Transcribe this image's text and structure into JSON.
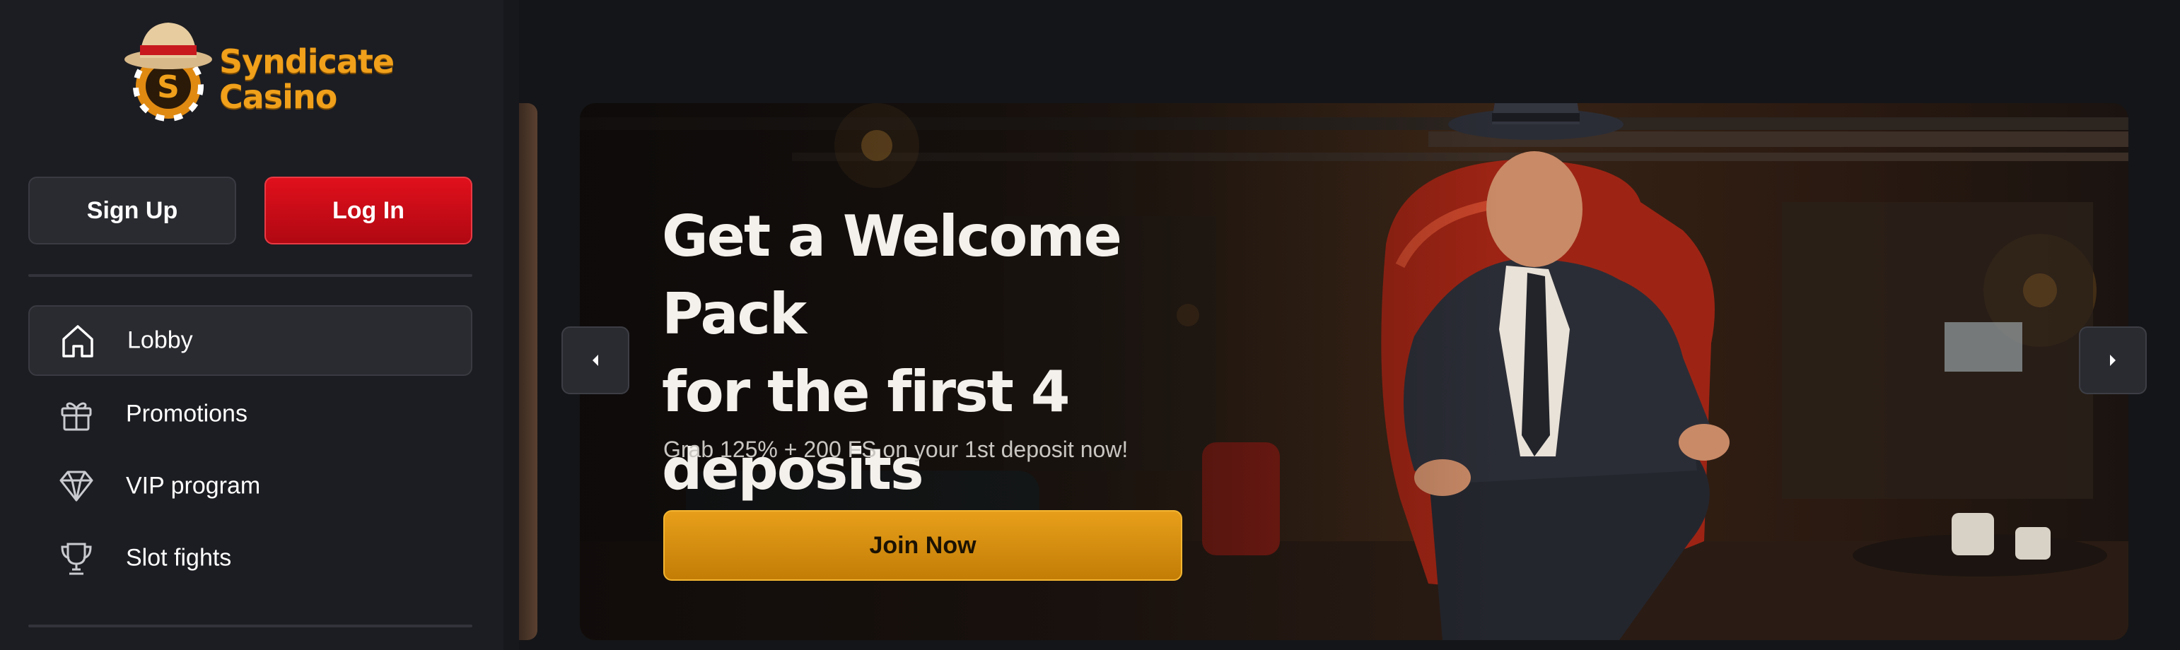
{
  "brand": {
    "logo_text_line1": "Syndicate",
    "logo_text_line2": "Casino",
    "accent": "#f0a01a"
  },
  "auth": {
    "signup_label": "Sign Up",
    "login_label": "Log In"
  },
  "nav": {
    "items": [
      {
        "label": "Lobby",
        "icon": "home-icon",
        "active": true
      },
      {
        "label": "Promotions",
        "icon": "gift-icon",
        "active": false
      },
      {
        "label": "VIP program",
        "icon": "diamond-icon",
        "active": false
      },
      {
        "label": "Slot fights",
        "icon": "trophy-icon",
        "active": false
      }
    ]
  },
  "banner": {
    "headline_line1": "Get a Welcome Pack",
    "headline_line2": "for the first 4",
    "headline_line3": "deposits",
    "subtext": "Grab 125% + 200 FS on your 1st deposit now!",
    "cta_label": "Join Now",
    "prev_icon": "caret-left-icon",
    "next_icon": "caret-right-icon"
  },
  "colors": {
    "login_red": "#d50d18",
    "cta_orange": "#e09513",
    "sidebar_bg": "#1c1d22"
  }
}
